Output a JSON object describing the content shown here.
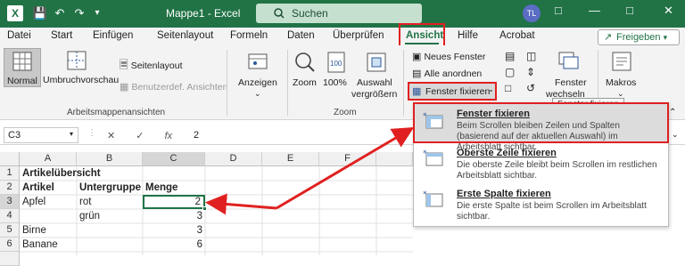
{
  "titlebar": {
    "doc_title": "Mappe1 - Excel",
    "search_placeholder": "Suchen",
    "avatar_initials": "TL",
    "accent": "#217346"
  },
  "menu": {
    "items": [
      "Datei",
      "Start",
      "Einfügen",
      "Seitenlayout",
      "Formeln",
      "Daten",
      "Überprüfen",
      "Ansicht",
      "Hilfe",
      "Acrobat"
    ],
    "active": "Ansicht",
    "share_label": "Freigeben"
  },
  "ribbon": {
    "views": {
      "normal": "Normal",
      "umbruch": "Umbruchvorschau",
      "seitenlayout": "Seitenlayout",
      "benutzerdef": "Benutzerdef. Ansichten",
      "group_label": "Arbeitsmappenansichten"
    },
    "anzeigen": "Anzeigen",
    "zoom": {
      "zoom": "Zoom",
      "hundred": "100%",
      "auswahl": "Auswahl",
      "auswahl2": "vergrößern",
      "group_label": "Zoom"
    },
    "fenster": {
      "neues": "Neues Fenster",
      "alle": "Alle anordnen",
      "fixieren": "Fenster fixieren",
      "wechseln1": "Fenster",
      "wechseln2": "wechseln",
      "makros": "Makros"
    },
    "tooltip": "Fenster fixieren"
  },
  "formula": {
    "namebox": "C3",
    "fx": "fx",
    "value": "2"
  },
  "grid": {
    "columns": [
      "A",
      "B",
      "C",
      "D",
      "E",
      "F"
    ],
    "rows": [
      {
        "num": "1",
        "a": "Artikelübersicht",
        "b": "",
        "c": ""
      },
      {
        "num": "2",
        "a": "Artikel",
        "b": "Untergruppe",
        "c": "Menge"
      },
      {
        "num": "3",
        "a": "Apfel",
        "b": "rot",
        "c": "2"
      },
      {
        "num": "4",
        "a": "",
        "b": "grün",
        "c": "3"
      },
      {
        "num": "5",
        "a": "Birne",
        "b": "",
        "c": "3"
      },
      {
        "num": "6",
        "a": "Banane",
        "b": "",
        "c": "6"
      }
    ]
  },
  "dropdown": {
    "items": [
      {
        "title": "Fenster fixieren",
        "desc": "Beim Scrollen bleiben Zeilen und Spalten (basierend auf der aktuellen Auswahl) im Arbeitsblatt sichtbar."
      },
      {
        "title": "Oberste Zeile fixieren",
        "desc": "Die oberste Zeile bleibt beim Scrollen im restlichen Arbeitsblatt sichtbar."
      },
      {
        "title": "Erste Spalte fixieren",
        "desc": "Die erste Spalte ist beim Scrollen im Arbeitsblatt sichtbar."
      }
    ]
  }
}
